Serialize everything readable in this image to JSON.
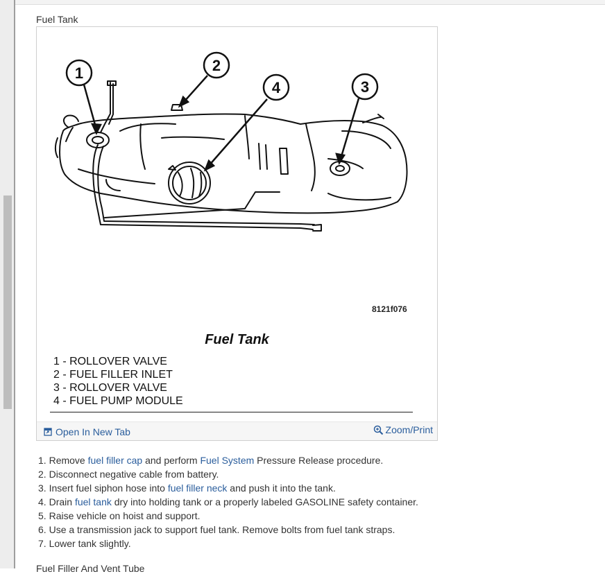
{
  "section_label": "Fuel Tank",
  "figure": {
    "callouts": [
      "1",
      "2",
      "3",
      "4"
    ],
    "code": "8121f076",
    "title": "Fuel Tank",
    "legend": [
      "1 - ROLLOVER VALVE",
      "2 - FUEL FILLER INLET",
      "3 - ROLLOVER VALVE",
      "4 - FUEL PUMP MODULE"
    ],
    "open_new_tab": "Open In New Tab",
    "zoom_print": "Zoom/Print"
  },
  "steps": [
    {
      "num": "1.",
      "pre": "Remove ",
      "link": "fuel filler cap",
      "mid": " and perform ",
      "link2": "Fuel System",
      "post": " Pressure Release procedure."
    },
    {
      "num": "2.",
      "pre": "Disconnect negative cable from battery.",
      "link": "",
      "mid": "",
      "link2": "",
      "post": ""
    },
    {
      "num": "3.",
      "pre": "Insert fuel siphon hose into ",
      "link": "fuel filler neck",
      "mid": " and push it into the tank.",
      "link2": "",
      "post": ""
    },
    {
      "num": "4.",
      "pre": "Drain ",
      "link": "fuel tank",
      "mid": " dry into holding tank or a properly labeled GASOLINE safety container.",
      "link2": "",
      "post": ""
    },
    {
      "num": "5.",
      "pre": "Raise vehicle on hoist and support.",
      "link": "",
      "mid": "",
      "link2": "",
      "post": ""
    },
    {
      "num": "6.",
      "pre": "Use a transmission jack to support fuel tank. Remove bolts from fuel tank straps.",
      "link": "",
      "mid": "",
      "link2": "",
      "post": ""
    },
    {
      "num": "7.",
      "pre": "Lower tank slightly.",
      "link": "",
      "mid": "",
      "link2": "",
      "post": ""
    }
  ],
  "next_heading": "Fuel Filler And Vent Tube"
}
